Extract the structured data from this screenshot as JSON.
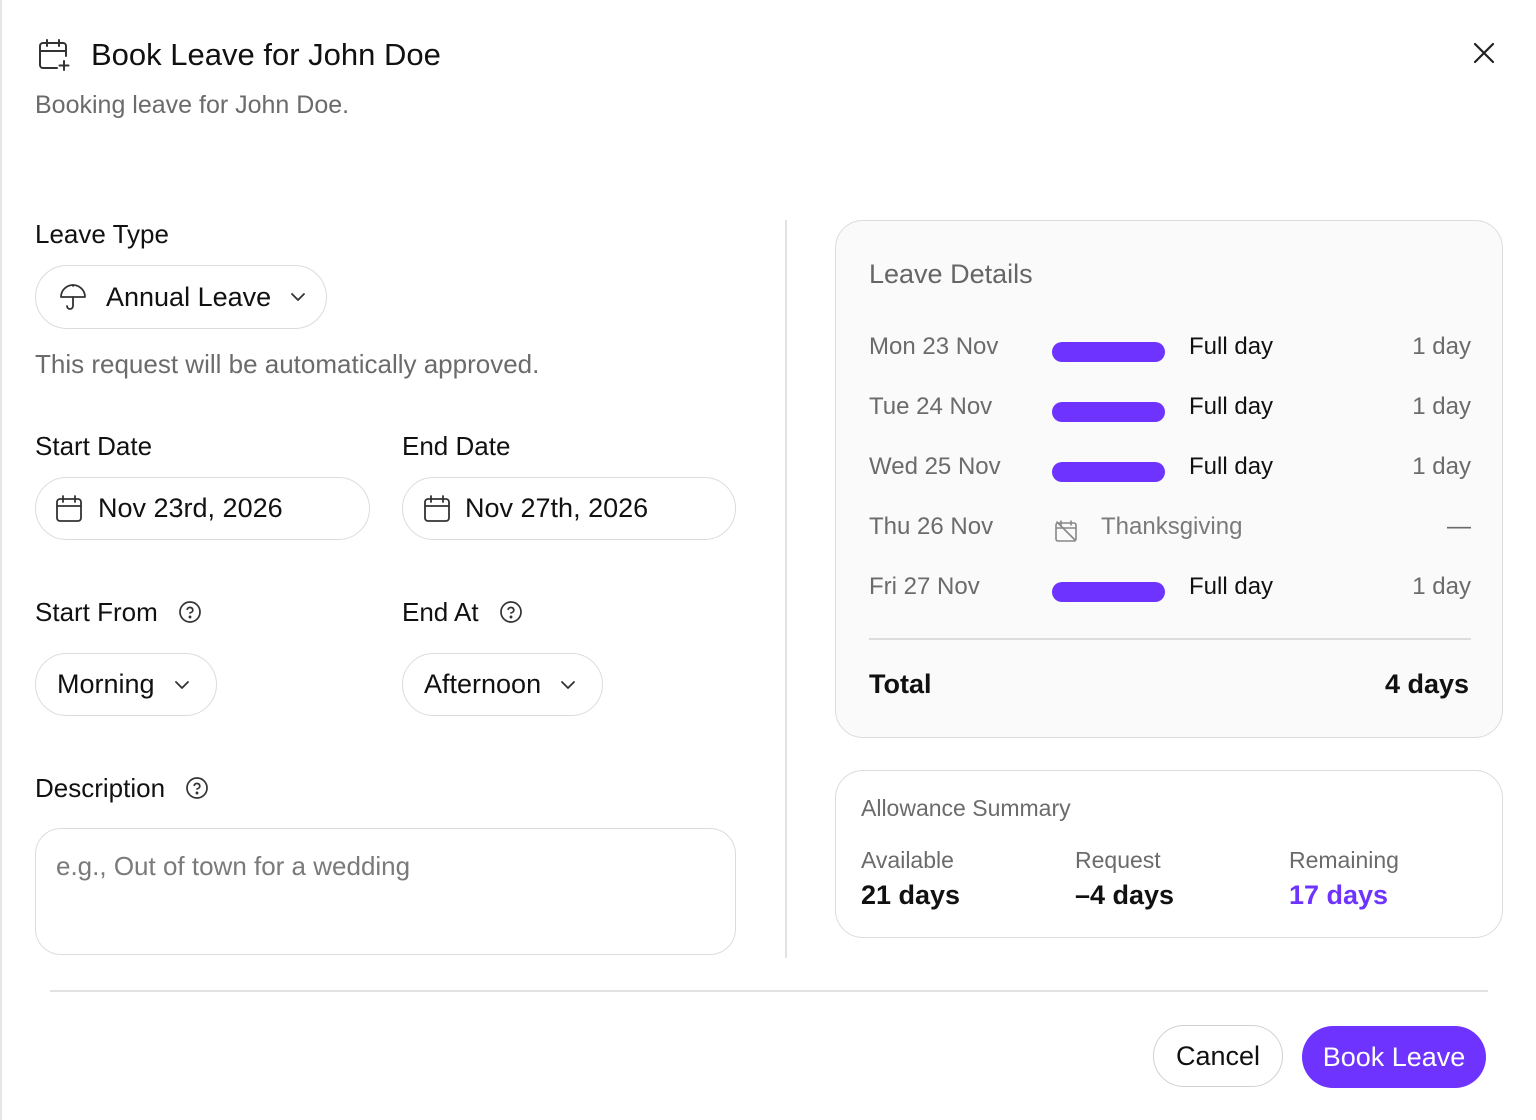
{
  "colors": {
    "accent": "#6e33ff",
    "muted_text": "#6b6b6b",
    "border": "#dcdcdc"
  },
  "header": {
    "icon": "calendar-plus-icon",
    "title": "Book Leave for John Doe",
    "subtitle": "Booking leave for John Doe."
  },
  "form": {
    "leave_type": {
      "label": "Leave Type",
      "value": "Annual Leave",
      "icon": "umbrella-icon"
    },
    "auto_approve_note": "This request will be automatically approved.",
    "start_date": {
      "label": "Start Date",
      "value": "Nov 23rd, 2026"
    },
    "end_date": {
      "label": "End Date",
      "value": "Nov 27th, 2026"
    },
    "start_from": {
      "label": "Start From",
      "value": "Morning"
    },
    "end_at": {
      "label": "End At",
      "value": "Afternoon"
    },
    "description": {
      "label": "Description",
      "placeholder": "e.g., Out of town for a wedding",
      "value": ""
    }
  },
  "leave_details": {
    "title": "Leave Details",
    "rows": [
      {
        "date": "Mon 23 Nov",
        "type": "Full day",
        "amount": "1 day",
        "holiday": false
      },
      {
        "date": "Tue 24 Nov",
        "type": "Full day",
        "amount": "1 day",
        "holiday": false
      },
      {
        "date": "Wed 25 Nov",
        "type": "Full day",
        "amount": "1 day",
        "holiday": false
      },
      {
        "date": "Thu 26 Nov",
        "type": "Thanksgiving",
        "amount": "—",
        "holiday": true
      },
      {
        "date": "Fri 27 Nov",
        "type": "Full day",
        "amount": "1 day",
        "holiday": false
      }
    ],
    "total_label": "Total",
    "total_value": "4 days"
  },
  "allowance": {
    "title": "Allowance Summary",
    "available_label": "Available",
    "available_value": "21 days",
    "request_label": "Request",
    "request_value": "–4 days",
    "remaining_label": "Remaining",
    "remaining_value": "17 days"
  },
  "footer": {
    "cancel_label": "Cancel",
    "submit_label": "Book Leave"
  }
}
